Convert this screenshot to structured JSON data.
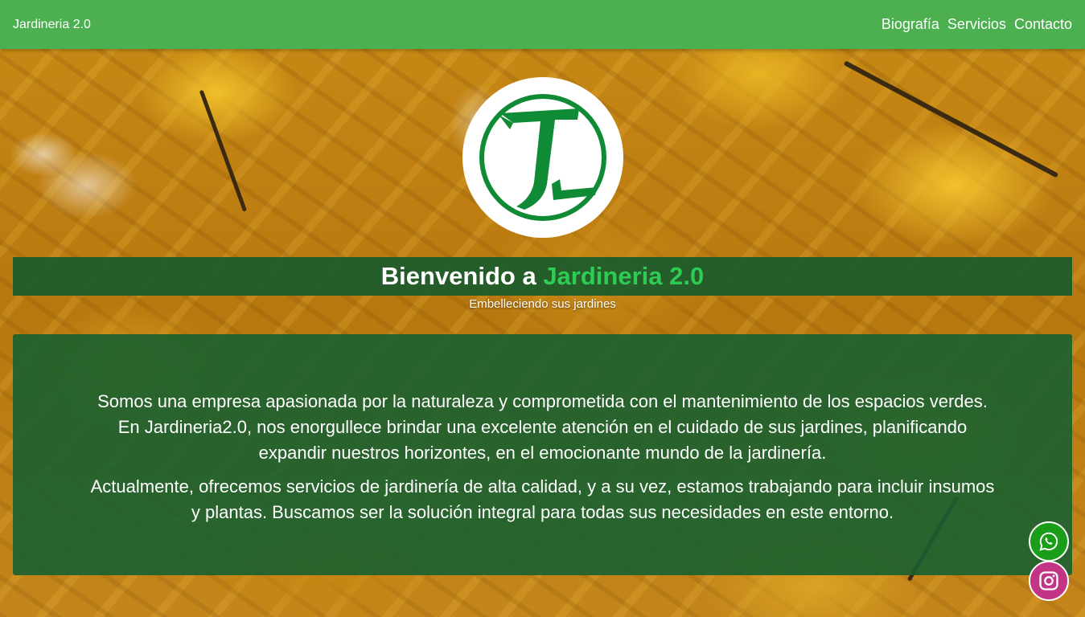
{
  "navbar": {
    "brand": "Jardineria 2.0",
    "links": [
      "Biografía",
      "Servicios",
      "Contacto"
    ]
  },
  "hero": {
    "title_prefix": "Bienvenido a ",
    "title_accent": "Jardineria 2.0",
    "subtitle": "Embelleciendo sus jardines"
  },
  "content": {
    "paragraphs": [
      "Somos una empresa apasionada por la naturaleza y comprometida con el mantenimiento de los espacios verdes. En Jardineria2.0, nos enorgullece brindar una excelente atención en el cuidado de sus jardines, planificando expandir nuestros horizontes, en el emocionante mundo de la jardinería.",
      "Actualmente, ofrecemos servicios de jardinería de alta calidad, y a su vez, estamos trabajando para incluir insumos y plantas. Buscamos ser la solución integral para todas sus necesidades en este entorno."
    ]
  },
  "social": {
    "whatsapp_icon": "whatsapp-icon",
    "instagram_icon": "instagram-icon"
  },
  "colors": {
    "navbar": "#4caf50",
    "accent": "#2ecc55",
    "panel": "#185f30",
    "whatsapp": "#1a9e1a",
    "instagram": "#c13584"
  }
}
